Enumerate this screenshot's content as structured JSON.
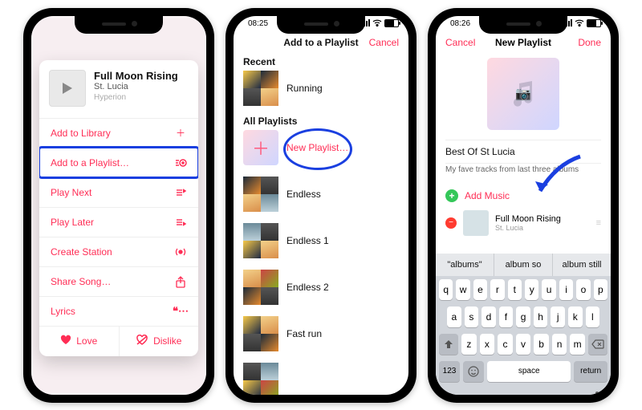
{
  "phone1": {
    "song": {
      "title": "Full Moon Rising",
      "artist": "St. Lucia",
      "album": "Hyperion"
    },
    "menu": {
      "library": "Add to Library",
      "playlist": "Add to a Playlist…",
      "playnext": "Play Next",
      "playlater": "Play Later",
      "station": "Create Station",
      "share": "Share Song…",
      "lyrics": "Lyrics"
    },
    "love": "Love",
    "dislike": "Dislike"
  },
  "phone2": {
    "time": "08:25",
    "title": "Add to a Playlist",
    "cancel": "Cancel",
    "recent_label": "Recent",
    "all_label": "All Playlists",
    "recent": [
      {
        "name": "Running"
      }
    ],
    "new_playlist": "New Playlist…",
    "all": [
      {
        "name": "Endless"
      },
      {
        "name": "Endless 1"
      },
      {
        "name": "Endless 2"
      },
      {
        "name": "Fast run"
      }
    ]
  },
  "phone3": {
    "time": "08:26",
    "nav_title": "New Playlist",
    "cancel": "Cancel",
    "done": "Done",
    "playlist_name": "Best Of St Lucia",
    "description": "My fave tracks from last three albums",
    "add_music": "Add Music",
    "track": {
      "title": "Full Moon Rising",
      "artist": "St. Lucia"
    },
    "suggestions": [
      "\"albums\"",
      "album so",
      "album still"
    ],
    "keyboard": {
      "r1": [
        "q",
        "w",
        "e",
        "r",
        "t",
        "y",
        "u",
        "i",
        "o",
        "p"
      ],
      "r2": [
        "a",
        "s",
        "d",
        "f",
        "g",
        "h",
        "j",
        "k",
        "l"
      ],
      "r3": [
        "z",
        "x",
        "c",
        "v",
        "b",
        "n",
        "m"
      ],
      "numkey": "123",
      "space": "space",
      "return": "return"
    }
  }
}
